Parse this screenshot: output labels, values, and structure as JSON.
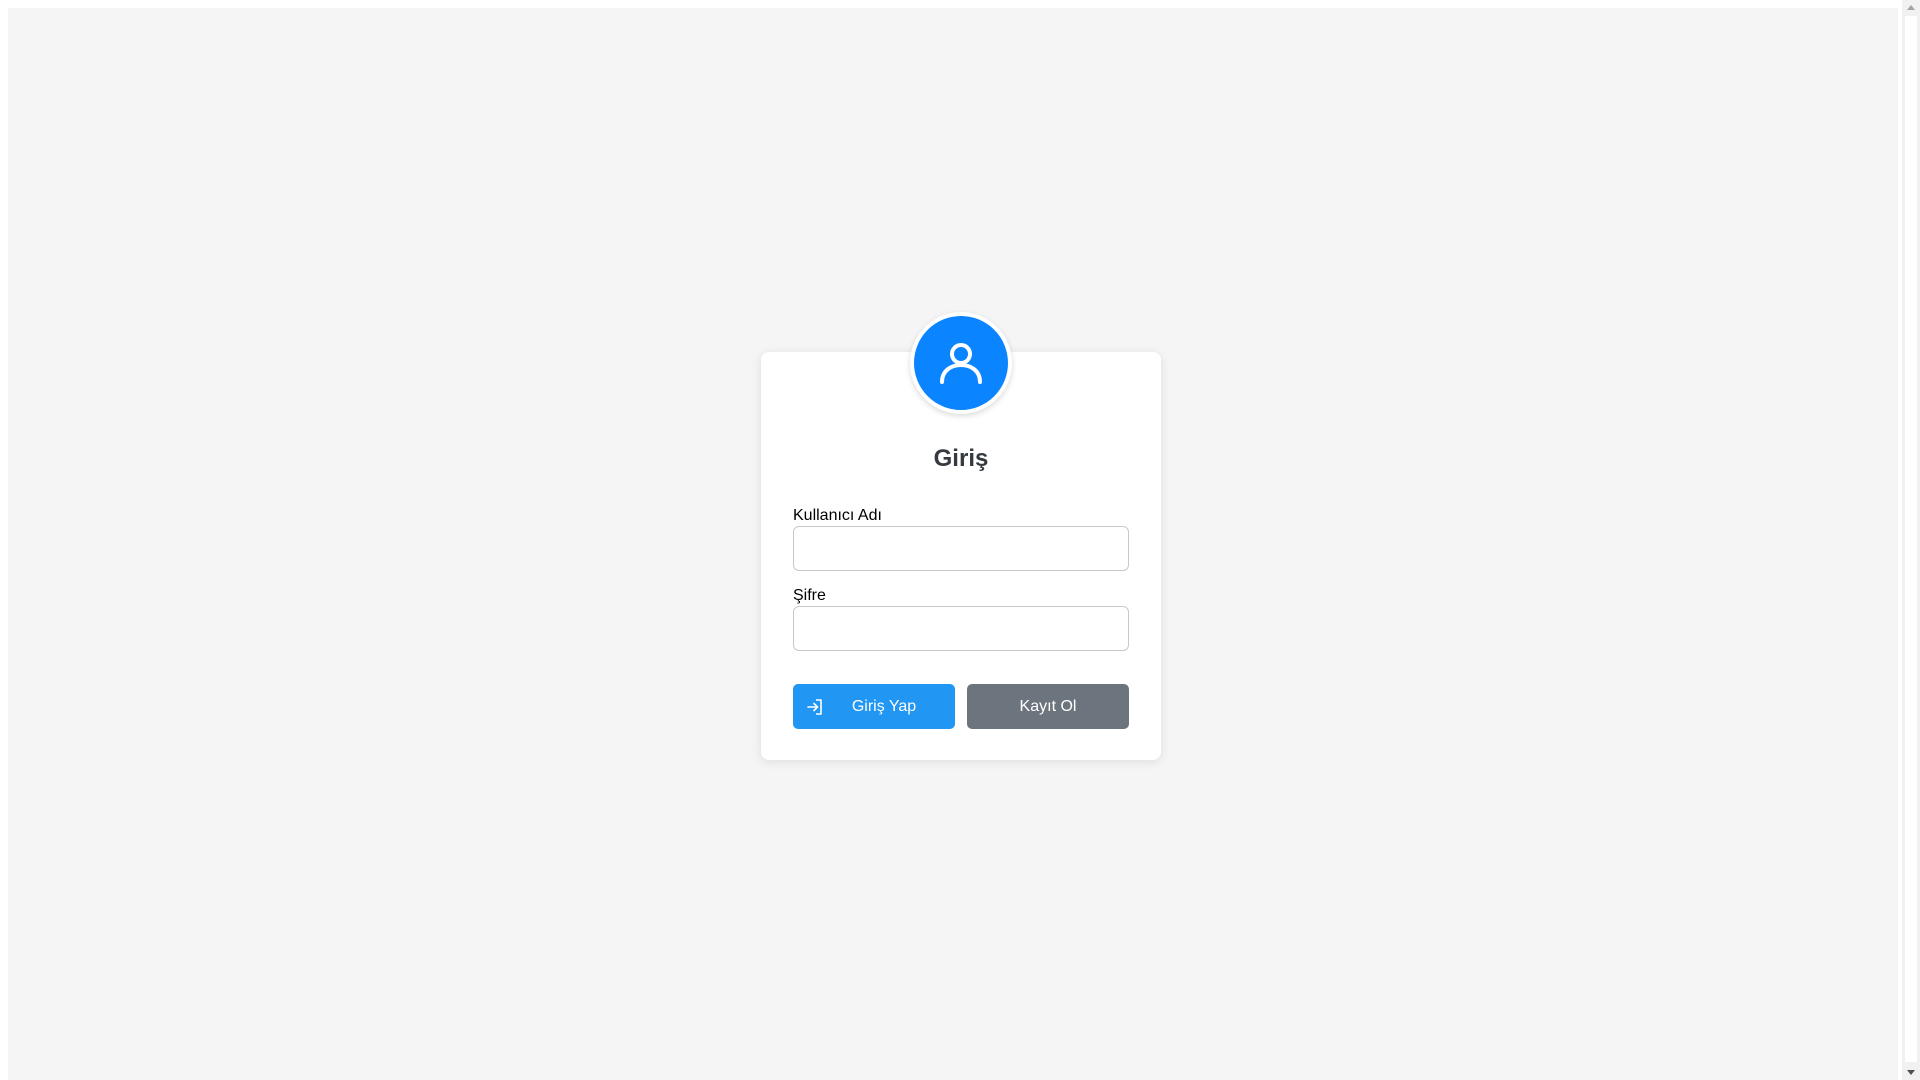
{
  "login": {
    "title": "Giriş",
    "username_label": "Kullanıcı Adı",
    "username_value": "",
    "password_label": "Şifre",
    "password_value": "",
    "login_button": "Giriş Yap",
    "register_button": "Kayıt Ol"
  },
  "icons": {
    "avatar": "user-icon",
    "login_button": "sign-in-icon"
  },
  "colors": {
    "background": "#f5f5f5",
    "avatar": "#0a84ff",
    "login_button": "#2196f3",
    "register_button": "#6c757d",
    "title": "#343a40"
  }
}
